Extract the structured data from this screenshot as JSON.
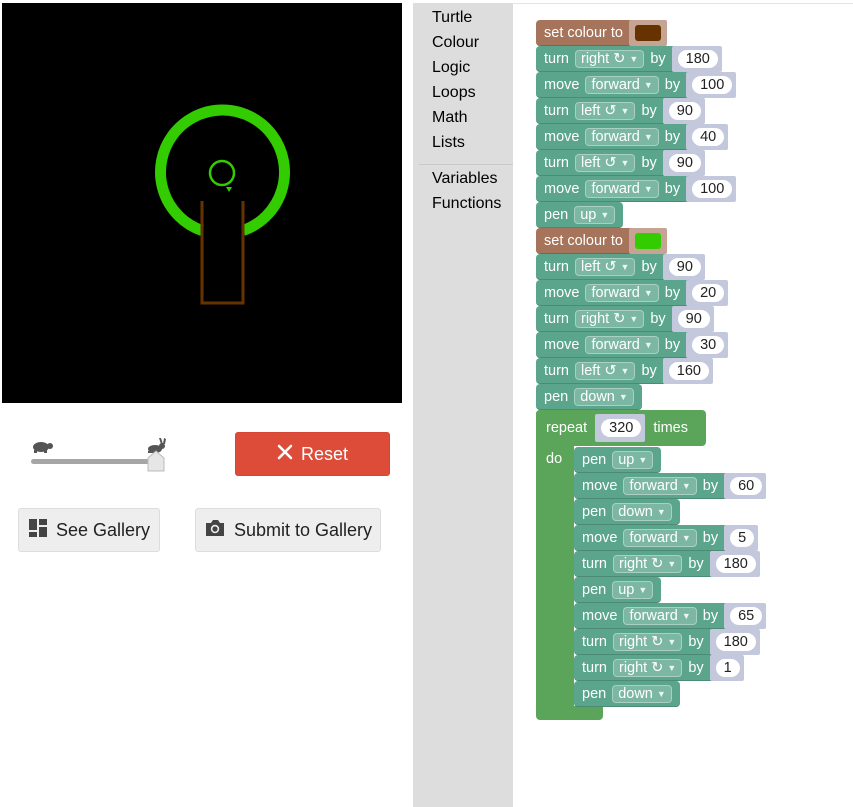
{
  "speed": {
    "value_fraction": 0.97
  },
  "buttons": {
    "reset": "Reset",
    "gallery": "See Gallery",
    "submit": "Submit to Gallery"
  },
  "toolbox": {
    "categories": [
      "Turtle",
      "Colour",
      "Logic",
      "Loops",
      "Math",
      "Lists"
    ],
    "extra": [
      "Variables",
      "Functions"
    ]
  },
  "blocks": [
    {
      "kind": "colour",
      "label": "set colour to",
      "color": "#663300"
    },
    {
      "kind": "turn",
      "label": "turn",
      "dir": "right ↻",
      "by": "by",
      "value": "180"
    },
    {
      "kind": "move",
      "label": "move",
      "dir": "forward",
      "by": "by",
      "value": "100"
    },
    {
      "kind": "turn",
      "label": "turn",
      "dir": "left ↺",
      "by": "by",
      "value": "90"
    },
    {
      "kind": "move",
      "label": "move",
      "dir": "forward",
      "by": "by",
      "value": "40"
    },
    {
      "kind": "turn",
      "label": "turn",
      "dir": "left ↺",
      "by": "by",
      "value": "90"
    },
    {
      "kind": "move",
      "label": "move",
      "dir": "forward",
      "by": "by",
      "value": "100"
    },
    {
      "kind": "pen",
      "label": "pen",
      "dir": "up"
    },
    {
      "kind": "colour",
      "label": "set colour to",
      "color": "#33cc00"
    },
    {
      "kind": "turn",
      "label": "turn",
      "dir": "left ↺",
      "by": "by",
      "value": "90"
    },
    {
      "kind": "move",
      "label": "move",
      "dir": "forward",
      "by": "by",
      "value": "20"
    },
    {
      "kind": "turn",
      "label": "turn",
      "dir": "right ↻",
      "by": "by",
      "value": "90"
    },
    {
      "kind": "move",
      "label": "move",
      "dir": "forward",
      "by": "by",
      "value": "30"
    },
    {
      "kind": "turn",
      "label": "turn",
      "dir": "left ↺",
      "by": "by",
      "value": "160"
    },
    {
      "kind": "pen",
      "label": "pen",
      "dir": "down"
    }
  ],
  "repeat": {
    "label": "repeat",
    "count": "320",
    "times": "times",
    "do": "do",
    "body": [
      {
        "kind": "pen",
        "label": "pen",
        "dir": "up"
      },
      {
        "kind": "move",
        "label": "move",
        "dir": "forward",
        "by": "by",
        "value": "60"
      },
      {
        "kind": "pen",
        "label": "pen",
        "dir": "down"
      },
      {
        "kind": "move",
        "label": "move",
        "dir": "forward",
        "by": "by",
        "value": "5"
      },
      {
        "kind": "turn",
        "label": "turn",
        "dir": "right ↻",
        "by": "by",
        "value": "180"
      },
      {
        "kind": "pen",
        "label": "pen",
        "dir": "up"
      },
      {
        "kind": "move",
        "label": "move",
        "dir": "forward",
        "by": "by",
        "value": "65"
      },
      {
        "kind": "turn",
        "label": "turn",
        "dir": "right ↻",
        "by": "by",
        "value": "180"
      },
      {
        "kind": "turn",
        "label": "turn",
        "dir": "right ↻",
        "by": "by",
        "value": "1"
      },
      {
        "kind": "pen",
        "label": "pen",
        "dir": "down"
      }
    ]
  },
  "colors": {
    "brown": "#663300",
    "green": "#33cc00",
    "reset": "#dd4b39"
  }
}
